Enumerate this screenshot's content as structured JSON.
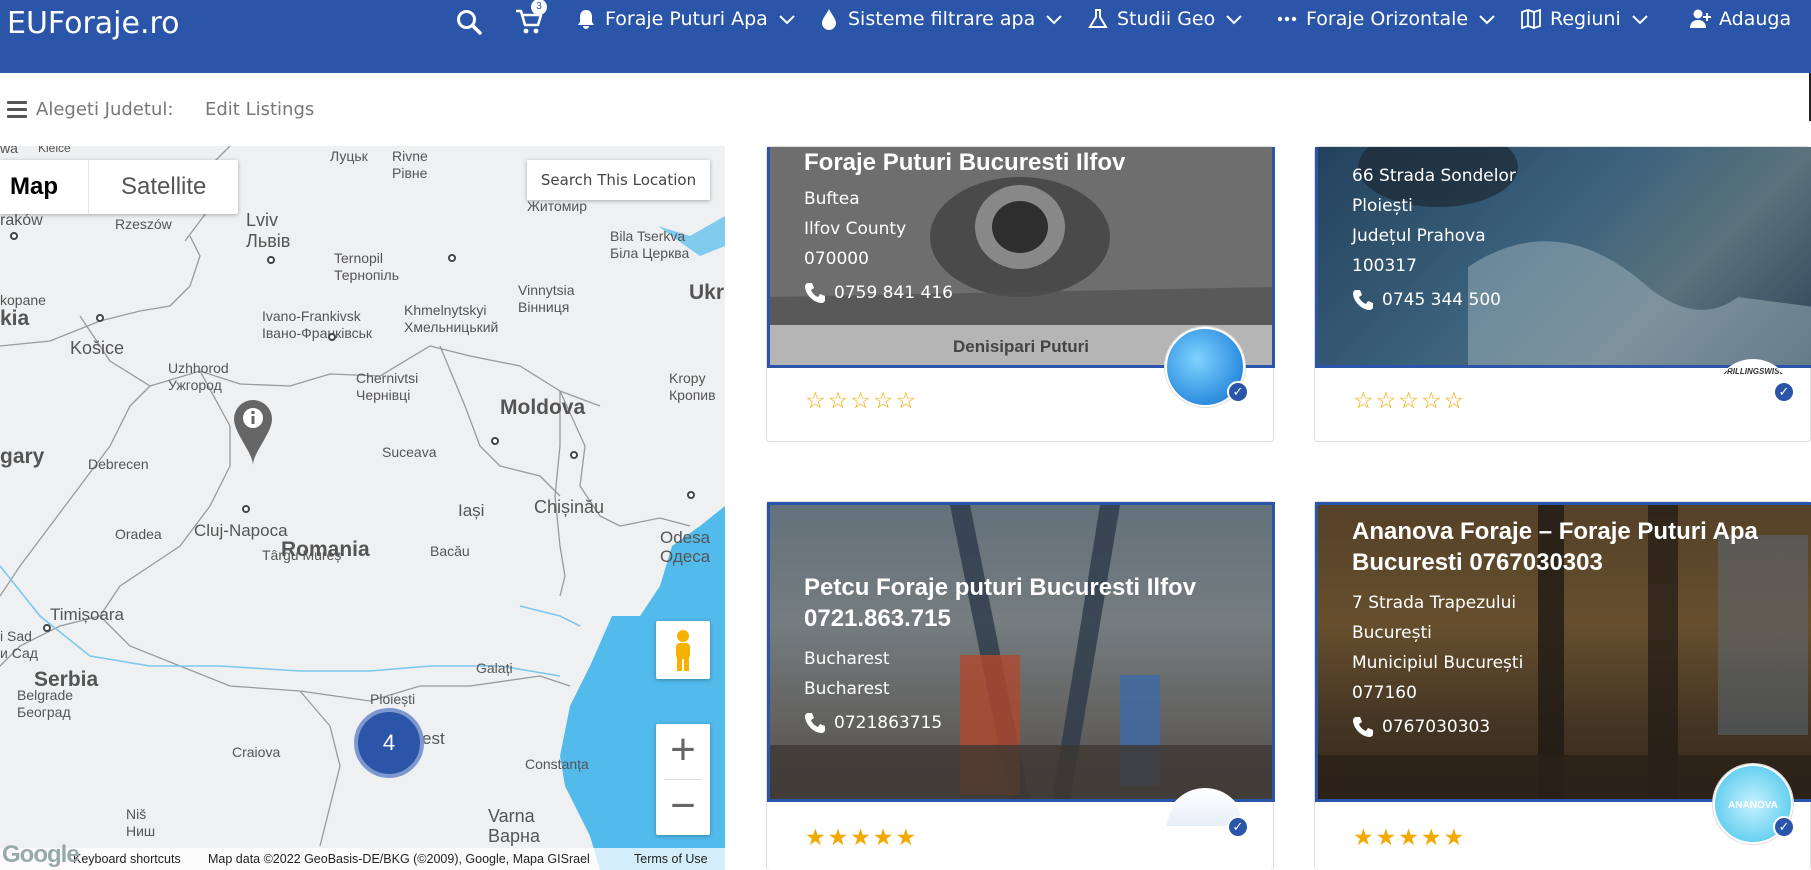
{
  "header": {
    "logo": "EUForaje.ro",
    "cart_count": "3",
    "nav": [
      {
        "label": "Foraje Puturi Apa"
      },
      {
        "label": "Sisteme filtrare apa"
      },
      {
        "label": "Studii Geo"
      },
      {
        "label": "Foraje Orizontale"
      },
      {
        "label": "Regiuni"
      },
      {
        "label": "Adauga"
      }
    ]
  },
  "subbar": {
    "county_label": "Alegeti Judetul:",
    "edit_listings": "Edit Listings"
  },
  "map": {
    "type_map": "Map",
    "type_satellite": "Satellite",
    "search_location": "Search This Location",
    "cluster_count": "4",
    "attribution": {
      "shortcuts": "Keyboard shortcuts",
      "data": "Map data ©2022 GeoBasis-DE/BKG (©2009), Google, Mapa GISrael",
      "terms": "Terms of Use",
      "logo": "Google"
    },
    "places": [
      {
        "t": "wa"
      },
      {
        "t": "Kielce"
      },
      {
        "t": "Луцьк"
      },
      {
        "t": "Rivne\nРівне"
      },
      {
        "t": "raków"
      },
      {
        "t": "Rzeszów"
      },
      {
        "t": "Lviv\nЛьвів"
      },
      {
        "t": "Ternopil\nТернопіль"
      },
      {
        "t": "Житомир"
      },
      {
        "t": "Bila Tserkva\nБіла Церква"
      },
      {
        "t": "Vinnytsia\nВінниця"
      },
      {
        "t": "kopane"
      },
      {
        "t": "Ivano-Frankivsk\nІвано-Франківськ"
      },
      {
        "t": "Khmelnytskyi\nХмельницький"
      },
      {
        "t": "Košice"
      },
      {
        "t": "Uzhhorod\nУжгород"
      },
      {
        "t": "Chernivtsi\nЧернівці"
      },
      {
        "t": "Kropy\nКропив"
      },
      {
        "t": "Debrecen"
      },
      {
        "t": "Suceava"
      },
      {
        "t": "Iași"
      },
      {
        "t": "Chișinău"
      },
      {
        "t": "Oradea"
      },
      {
        "t": "Cluj-Napoca"
      },
      {
        "t": "Târgu Mureș"
      },
      {
        "t": "Bacău"
      },
      {
        "t": "Odesa\nОдеса"
      },
      {
        "t": "Timișoara"
      },
      {
        "t": "i Sad\nи Сад"
      },
      {
        "t": "Belgrade\nБеоград"
      },
      {
        "t": "Galați"
      },
      {
        "t": "Ploiești"
      },
      {
        "t": "est"
      },
      {
        "t": "Craiova"
      },
      {
        "t": "Constanța"
      },
      {
        "t": "Niš\nНиш"
      },
      {
        "t": "Varna\nВарна"
      }
    ],
    "big": [
      {
        "t": "kia"
      },
      {
        "t": "gary"
      },
      {
        "t": "Ukr"
      },
      {
        "t": "Romania"
      },
      {
        "t": "Moldova"
      },
      {
        "t": "Serbia"
      }
    ]
  },
  "listings": [
    {
      "title": "Foraje Puturi Bucuresti Ilfov",
      "lines": [
        "Buftea",
        "Ilfov County",
        "070000"
      ],
      "phone": "0759 841 416",
      "photo_caption": "Denisipari Puturi",
      "stars": "☆☆☆☆☆"
    },
    {
      "title": "",
      "lines": [
        "66 Strada Sondelor",
        "Ploiești",
        "Județul Prahova",
        "100317"
      ],
      "phone": "0745 344 500",
      "badge_text": "DRILLINGSWISS",
      "stars": "☆☆☆☆☆"
    },
    {
      "title": "Petcu Foraje puturi Bucuresti Ilfov 0721.863.715",
      "lines": [
        "Bucharest",
        "Bucharest"
      ],
      "phone": "0721863715",
      "stars": "★★★★★"
    },
    {
      "title": "Ananova Foraje – Foraje Puturi Apa Bucuresti 0767030303",
      "lines": [
        "7 Strada Trapezului",
        "București",
        "Municipiul București",
        "077160"
      ],
      "phone": "0767030303",
      "badge_text": "ANANOVA FORAJE",
      "stars": "★★★★★"
    }
  ]
}
